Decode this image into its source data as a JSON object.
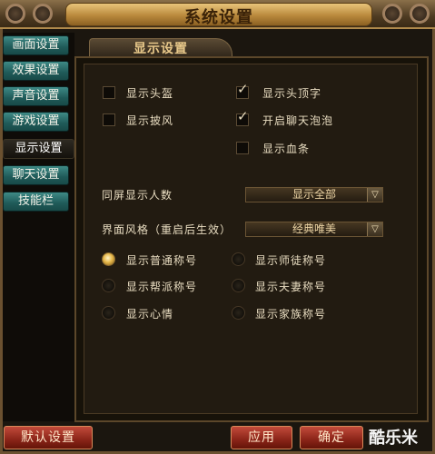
{
  "window": {
    "title": "系统设置"
  },
  "sidebar": {
    "items": [
      {
        "label": "画面设置",
        "active": false
      },
      {
        "label": "效果设置",
        "active": false
      },
      {
        "label": "声音设置",
        "active": false
      },
      {
        "label": "游戏设置",
        "active": false
      },
      {
        "label": "显示设置",
        "active": true
      },
      {
        "label": "聊天设置",
        "active": false
      },
      {
        "label": "技能栏",
        "active": false
      }
    ]
  },
  "panel": {
    "tab": "显示设置",
    "checkboxes": [
      {
        "label": "显示头盔",
        "checked": false
      },
      {
        "label": "显示披风",
        "checked": false
      },
      {
        "label": "显示头顶字",
        "checked": true
      },
      {
        "label": "开启聊天泡泡",
        "checked": true
      },
      {
        "label": "显示血条",
        "checked": false
      }
    ],
    "selects": [
      {
        "label": "同屏显示人数",
        "value": "显示全部"
      },
      {
        "label": "界面风格（重启后生效）",
        "value": "经典唯美"
      }
    ],
    "radios": [
      {
        "label": "显示普通称号",
        "checked": true
      },
      {
        "label": "显示师徒称号",
        "checked": false
      },
      {
        "label": "显示帮派称号",
        "checked": false
      },
      {
        "label": "显示夫妻称号",
        "checked": false
      },
      {
        "label": "显示心情",
        "checked": false
      },
      {
        "label": "显示家族称号",
        "checked": false
      }
    ]
  },
  "footer": {
    "default_label": "默认设置",
    "apply_label": "应用",
    "ok_label": "确定",
    "watermark": "酷乐米"
  },
  "icons": {
    "checkbox_tick": "✓",
    "dropdown_arrow": "▽"
  },
  "colors": {
    "accent_teal": "#2f7a76",
    "gold": "#e6b84a",
    "button_red": "#8a2418"
  }
}
